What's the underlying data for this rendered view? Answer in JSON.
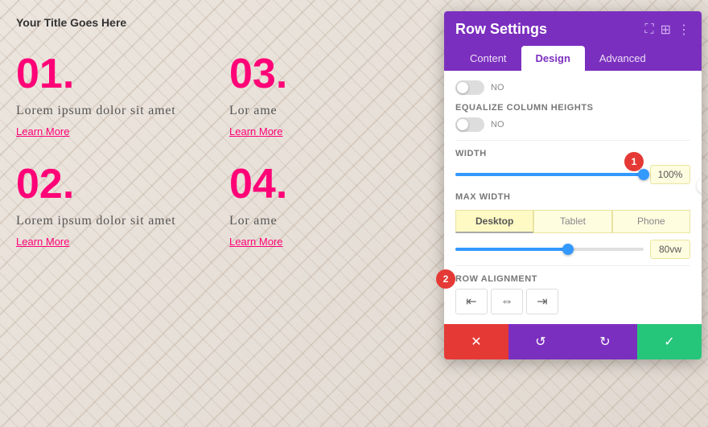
{
  "page": {
    "title": "Your Title Goes Here"
  },
  "grid_items": [
    {
      "number": "01.",
      "text": "Lorem ipsum dolor sit amet",
      "link": "Learn More"
    },
    {
      "number": "03.",
      "text": "Lor ame",
      "link": "Learn More"
    },
    {
      "number": "02.",
      "text": "Lorem ipsum dolor sit amet",
      "link": "Learn More"
    },
    {
      "number": "04.",
      "text": "Lor ame",
      "link": "Learn More"
    }
  ],
  "panel": {
    "title": "Row Settings",
    "tabs": [
      {
        "label": "Content",
        "active": false
      },
      {
        "label": "Design",
        "active": true
      },
      {
        "label": "Advanced",
        "active": false
      }
    ],
    "sections": {
      "equalize_label": "Equalize Column Heights",
      "width_label": "Width",
      "width_value": "100%",
      "max_width_label": "Max Width",
      "max_width_value": "80vw",
      "row_alignment_label": "Row Alignment"
    },
    "device_tabs": [
      "Desktop",
      "Tablet",
      "Phone"
    ],
    "active_device": "Desktop",
    "footer": {
      "cancel": "✕",
      "undo": "↺",
      "redo": "↻",
      "save": "✓"
    },
    "badge1": "1",
    "badge2": "2"
  }
}
